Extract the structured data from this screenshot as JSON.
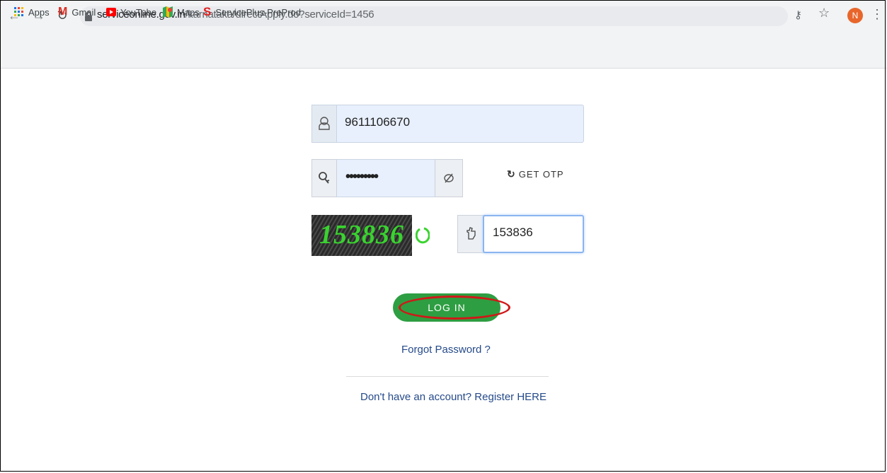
{
  "browser": {
    "url_domain": "serviceonline.gov.in",
    "url_path": "/karnataka/directApply.do?serviceId=1456",
    "avatar_initial": "N",
    "bookmarks": [
      {
        "label": "Apps",
        "icon": "apps-grid-icon"
      },
      {
        "label": "Gmail",
        "icon": "gmail-icon"
      },
      {
        "label": "YouTube",
        "icon": "youtube-icon"
      },
      {
        "label": "Maps",
        "icon": "maps-icon"
      },
      {
        "label": "ServicePlus-PreProd",
        "icon": "serviceplus-icon"
      }
    ]
  },
  "login": {
    "username_value": "9611106670",
    "password_value": "•••••••••",
    "get_otp_label": "GET OTP",
    "captcha_text": "153836",
    "captcha_input_value": "153836",
    "login_label": "LOG IN",
    "forgot_label": "Forgot Password ?",
    "register_label": "Don't have an account? Register HERE"
  },
  "colors": {
    "login_button": "#2e9e42",
    "highlight_ring": "#d01818",
    "captcha_text": "#39d32f",
    "link": "#254a8a"
  }
}
